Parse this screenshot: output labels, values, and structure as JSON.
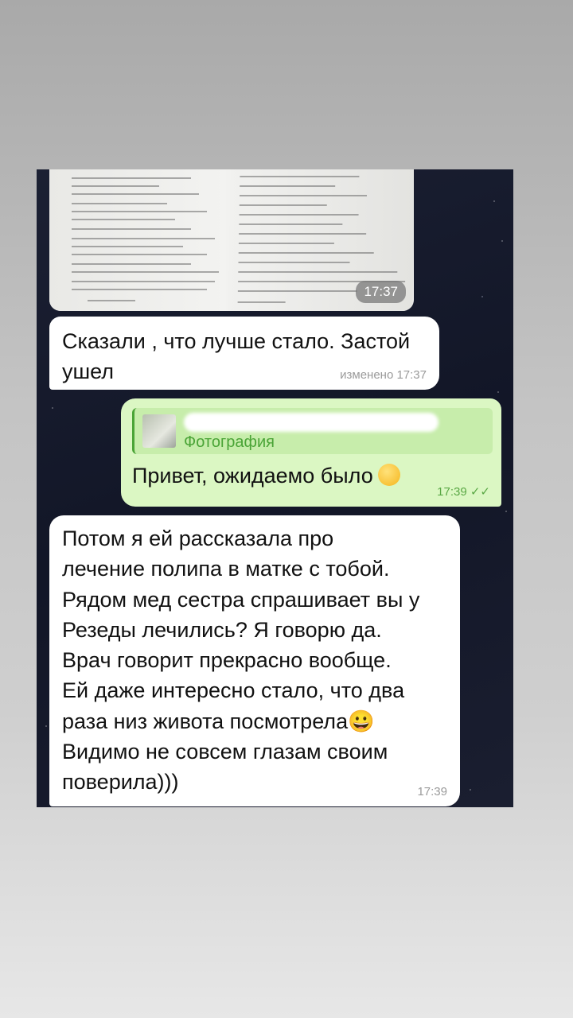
{
  "messages": [
    {
      "type": "photo",
      "direction": "incoming",
      "time": "17:37"
    },
    {
      "type": "text",
      "direction": "incoming",
      "text": "Сказали , что лучше стало. Застой ушел",
      "meta": "изменено 17:37"
    },
    {
      "type": "reply",
      "direction": "outgoing",
      "quote_label": "Фотография",
      "text": "Привет, ожидаемо было",
      "emoji": "smiling-face",
      "time": "17:39",
      "status": "✓✓"
    },
    {
      "type": "text",
      "direction": "incoming",
      "text": "Потом я ей рассказала про\nлечение полипа в матке с тобой.\nРядом мед сестра спрашивает вы у\nРезеды лечились? Я говорю да.\nВрач говорит прекрасно вообще.\nЕй даже интересно стало, что два\nраза низ живота посмотрела😀\nВидимо не совсем глазам своим\nповерила)))",
      "time": "17:39"
    }
  ],
  "colors": {
    "outgoing_bubble": "#dbf7c3",
    "incoming_bubble": "#ffffff",
    "accent_green": "#4aa436",
    "chat_background": "#161b2c"
  }
}
